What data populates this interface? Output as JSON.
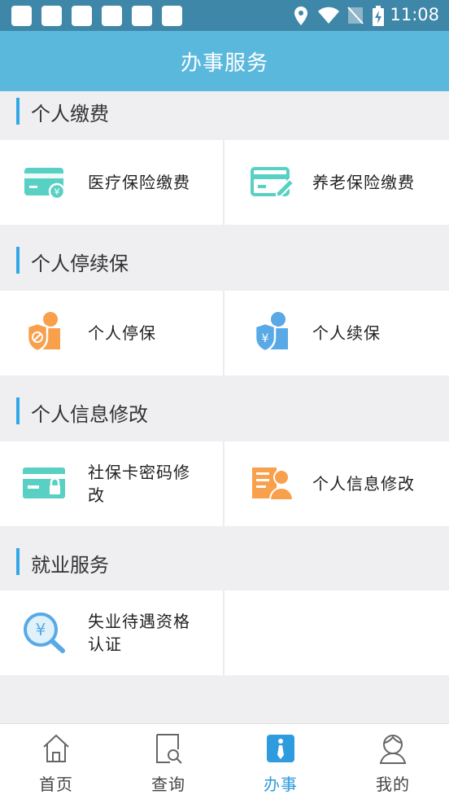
{
  "status_bar": {
    "time": "11:08"
  },
  "header": {
    "title": "办事服务"
  },
  "sections": [
    {
      "label": "个人缴费",
      "items": [
        "医疗保险缴费",
        "养老保险缴费"
      ]
    },
    {
      "label": "个人停续保",
      "items": [
        "个人停保",
        "个人续保"
      ]
    },
    {
      "label": "个人信息修改",
      "items": [
        "社保卡密码修改",
        "个人信息修改"
      ]
    },
    {
      "label": "就业服务",
      "items": [
        "失业待遇资格认证"
      ]
    }
  ],
  "tabs": [
    {
      "label": "首页"
    },
    {
      "label": "查询"
    },
    {
      "label": "办事"
    },
    {
      "label": "我的"
    }
  ],
  "active_tab": "办事",
  "colors": {
    "header": "#5bb8dd",
    "status": "#3f87a8",
    "accent": "#33a8e8",
    "teal": "#58d0c3",
    "orange": "#f8a04c",
    "blue": "#58a9e6"
  }
}
